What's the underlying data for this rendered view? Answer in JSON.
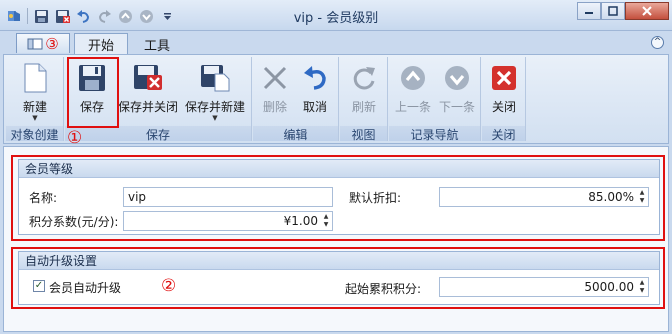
{
  "window": {
    "title": "vip - 会员级别"
  },
  "quick_access": {
    "icons": [
      "app-icon",
      "save-icon",
      "save-close-icon",
      "undo-icon",
      "redo-icon",
      "up-icon",
      "down-icon",
      "customize-dropdown-icon"
    ]
  },
  "tabs": {
    "app_badge": "③",
    "start": "开始",
    "tools": "工具"
  },
  "ribbon": {
    "groups": [
      {
        "label": "对象创建"
      },
      {
        "label": "保存"
      },
      {
        "label": "编辑"
      },
      {
        "label": "视图"
      },
      {
        "label": "记录导航"
      },
      {
        "label": "关闭"
      }
    ],
    "buttons": {
      "new": "新建",
      "save": "保存",
      "save_close": "保存并关闭",
      "save_new": "保存并新建",
      "delete": "删除",
      "cancel": "取消",
      "refresh": "刷新",
      "prev": "上一条",
      "next": "下一条",
      "close": "关闭"
    }
  },
  "annotations": {
    "one": "①",
    "two": "②"
  },
  "member_level": {
    "header": "会员等级",
    "name_label": "名称:",
    "name_value": "vip",
    "discount_label": "默认折扣:",
    "discount_value": "85.00%",
    "points_label": "积分系数(元/分):",
    "points_value": "¥1.00"
  },
  "auto_upgrade": {
    "header": "自动升级设置",
    "checkbox_label": "会员自动升级",
    "checkbox_checked": true,
    "start_points_label": "起始累积积分:",
    "start_points_value": "5000.00"
  },
  "colors": {
    "annotation_red": "#e01010",
    "ribbon_bg": "#dbe6f4",
    "close_red": "#c4503e"
  }
}
